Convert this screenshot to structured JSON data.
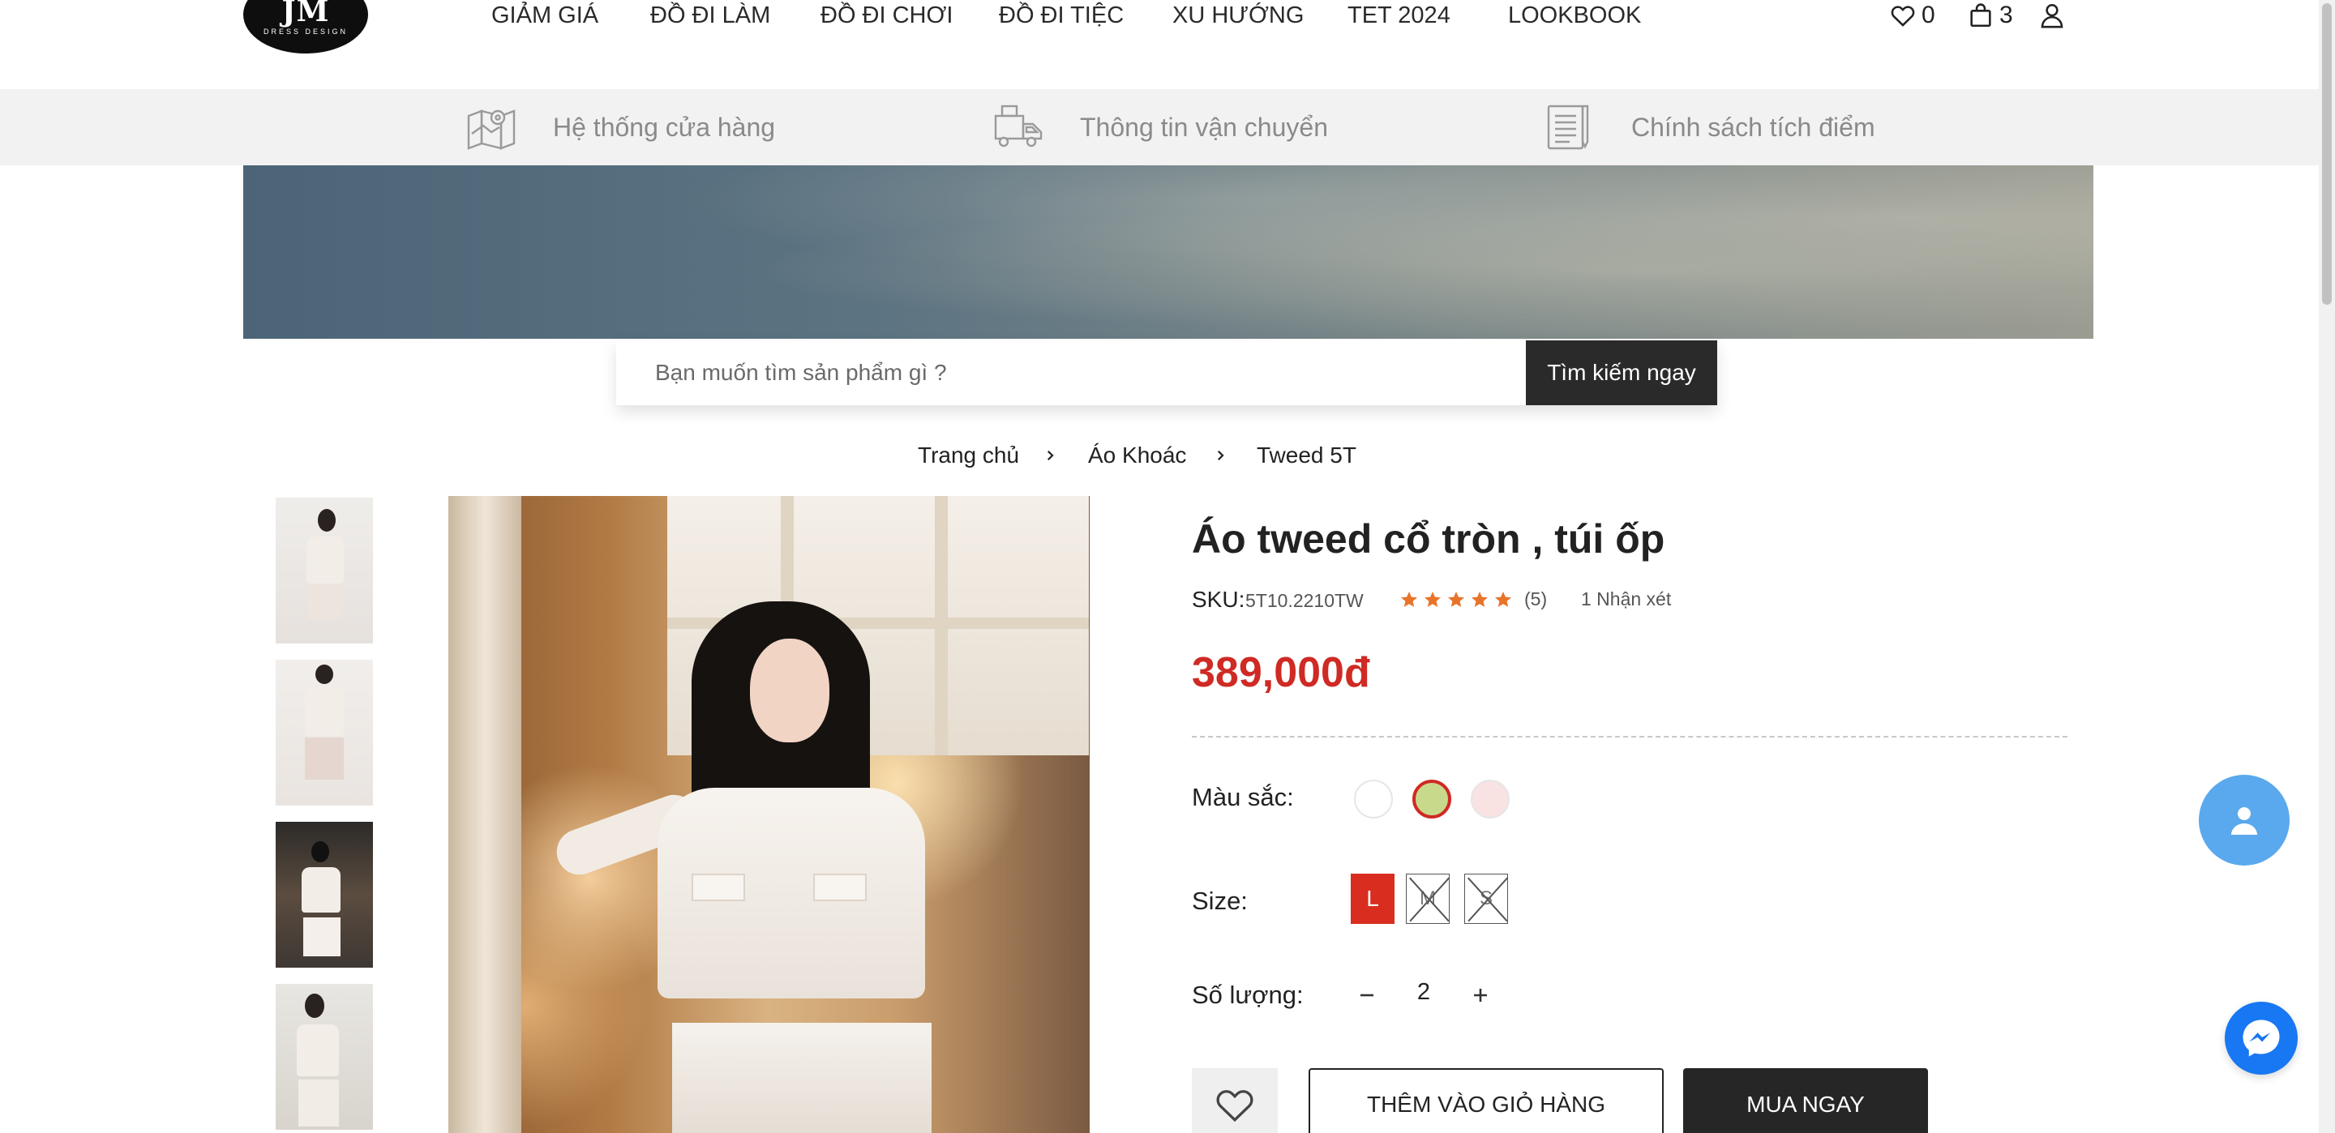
{
  "header": {
    "logo": {
      "mark": "JM",
      "sub": "DRESS DESIGN"
    },
    "nav": [
      "GIẢM GIÁ",
      "ĐỒ ĐI LÀM",
      "ĐỒ ĐI CHƠI",
      "ĐỒ ĐI TIỆC",
      "XU HƯỚNG",
      "TET 2024",
      "LOOKBOOK"
    ],
    "wishlist_count": "0",
    "cart_count": "3"
  },
  "infobar": [
    {
      "label": "Hệ thống cửa hàng",
      "icon": "map-icon"
    },
    {
      "label": "Thông tin vận chuyển",
      "icon": "truck-icon"
    },
    {
      "label": "Chính sách tích điểm",
      "icon": "document-pen-icon"
    }
  ],
  "search": {
    "placeholder": "Bạn muốn tìm sản phẩm gì ?",
    "button": "Tìm kiếm ngay"
  },
  "breadcrumb": [
    "Trang chủ",
    "Áo Khoác",
    "Tweed 5T"
  ],
  "product": {
    "title": "Áo tweed cổ tròn , túi ốp",
    "sku_label": "SKU:",
    "sku": "5T10.2210TW",
    "rating": 5,
    "rating_count": "(5)",
    "reviews": "1 Nhận xét",
    "price": "389,000đ",
    "color_label": "Màu sắc:",
    "colors": [
      "#ffffff",
      "#c9d98b",
      "#f9e2e2"
    ],
    "selected_color": 1,
    "size_label": "Size:",
    "sizes": [
      {
        "label": "L",
        "available": true,
        "selected": true
      },
      {
        "label": "M",
        "available": false,
        "selected": false
      },
      {
        "label": "S",
        "available": false,
        "selected": false
      }
    ],
    "qty_label": "Số lượng:",
    "quantity": "2",
    "add_to_cart": "THÊM VÀO GIỎ HÀNG",
    "buy_now": "MUA NGAY"
  },
  "colors": {
    "accent": "#cf2a24",
    "star": "#e8742a",
    "fab": "#5aa8ed",
    "messenger": "#1877f2"
  }
}
